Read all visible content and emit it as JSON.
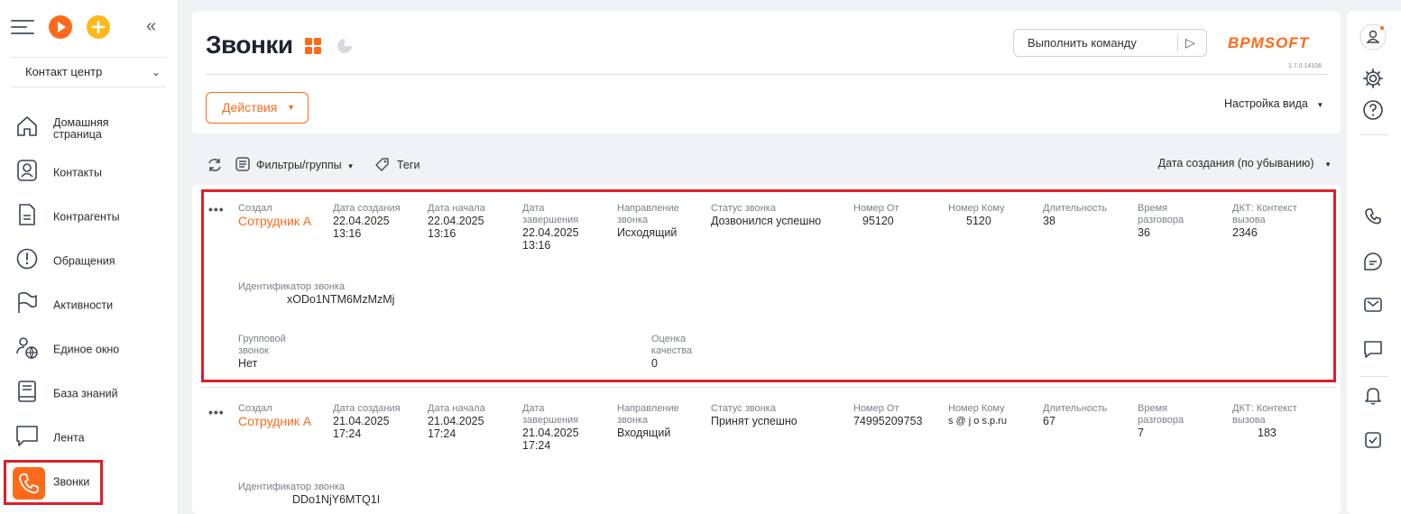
{
  "sidebar": {
    "workplace": "Контакт центр",
    "items": [
      {
        "label": "Домашняя страница"
      },
      {
        "label": "Контакты"
      },
      {
        "label": "Контрагенты"
      },
      {
        "label": "Обращения"
      },
      {
        "label": "Активности"
      },
      {
        "label": "Единое окно"
      },
      {
        "label": "База знаний"
      },
      {
        "label": "Лента"
      },
      {
        "label": "Звонки"
      }
    ]
  },
  "header": {
    "title": "Звонки",
    "command_placeholder": "Выполнить команду",
    "logo": "BPMSOFT",
    "version": "1.7.0.14106",
    "actions_label": "Действия",
    "view_setup_label": "Настройка вида"
  },
  "toolbar": {
    "filters_label": "Фильтры/группы",
    "tags_label": "Теги",
    "sort_label": "Дата создания (по убыванию)"
  },
  "labels": {
    "created_by": "Создал",
    "created_on": "Дата создания",
    "start_date": "Дата начала",
    "end_date": "Дата завершения",
    "direction": "Направление звонка",
    "status": "Статус звонка",
    "from": "Номер От",
    "to": "Номер Кому",
    "duration": "Длительность",
    "talk_time": "Время разговора",
    "context": "ДКТ: Контекст вызова",
    "call_id": "Идентификатор звонка",
    "group_call": "Групповой звонок",
    "quality": "Оценка качества"
  },
  "records": [
    {
      "created_by": "Сотрудник А",
      "created_on": "22.04.2025 13:16",
      "start_date": "22.04.2025 13:16",
      "end_date": "22.04.2025 13:16",
      "direction": "Исходящий",
      "status": "Дозвонился успешно",
      "from": "95120",
      "to": "5120",
      "duration": "38",
      "talk_time": "36",
      "context": "2346",
      "call_id": "xODo1NTM6MzMzMj",
      "group_call": "Нет",
      "quality": "0"
    },
    {
      "created_by": "Сотрудник А",
      "created_on": "21.04.2025 17:24",
      "start_date": "21.04.2025 17:24",
      "end_date": "21.04.2025 17:24",
      "direction": "Входящий",
      "status": "Принят успешно",
      "from": "74995209753",
      "to": "s @ j o s.p.ru",
      "duration": "67",
      "talk_time": "7",
      "context": "183",
      "call_id": "DDo1NjY6MTQ1I"
    }
  ]
}
